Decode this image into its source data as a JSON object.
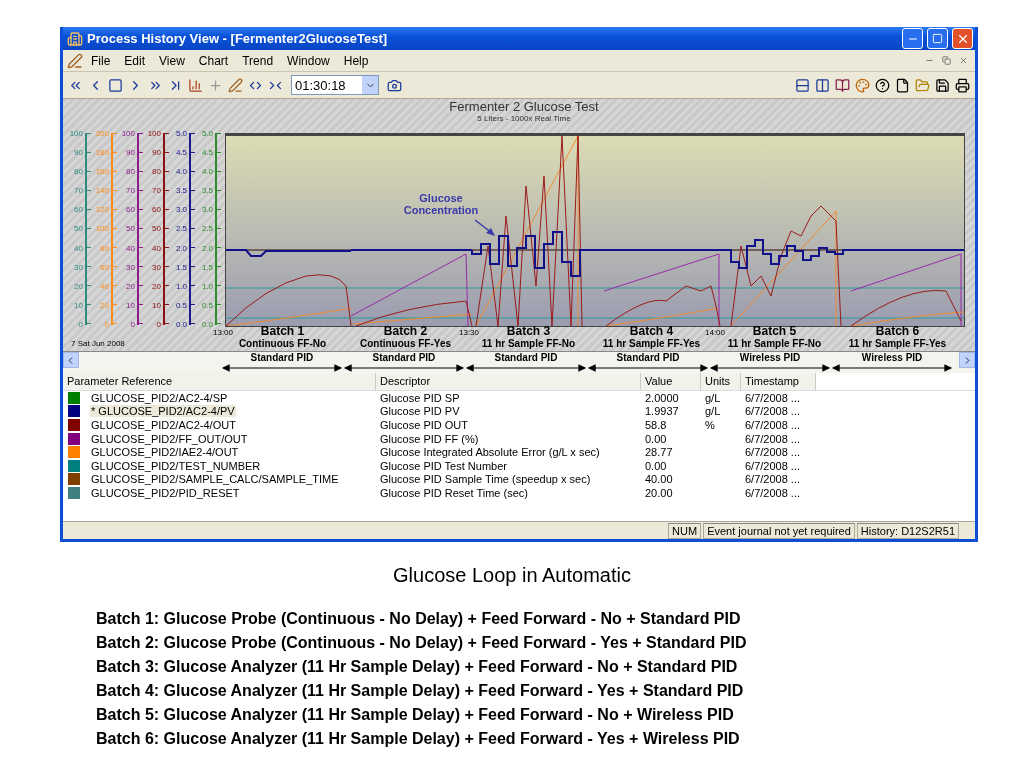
{
  "window": {
    "title": "Process History View - [Fermenter2GlucoseTest]"
  },
  "menu": [
    "File",
    "Edit",
    "View",
    "Chart",
    "Trend",
    "Window",
    "Help"
  ],
  "toolbar": {
    "time_value": "01:30:18"
  },
  "chart": {
    "title": "Fermenter 2 Glucose Test",
    "subtitle": "5 Liters - 1000x Real Time",
    "date": "7 Sat Jun 2008",
    "annotation": "Glucose Concentration",
    "axes": [
      {
        "color": "#2e8b80",
        "ticks": [
          "100",
          "90",
          "80",
          "70",
          "60",
          "50",
          "40",
          "30",
          "20",
          "10",
          "0"
        ]
      },
      {
        "color": "#ff8c1a",
        "ticks": [
          "200",
          "180",
          "160",
          "140",
          "120",
          "100",
          "80",
          "60",
          "40",
          "20",
          "0"
        ]
      },
      {
        "color": "#8b1a8b",
        "ticks": [
          "100",
          "90",
          "80",
          "70",
          "60",
          "50",
          "40",
          "30",
          "20",
          "10",
          "0"
        ]
      },
      {
        "color": "#8b1010",
        "ticks": [
          "100",
          "90",
          "80",
          "70",
          "60",
          "50",
          "40",
          "30",
          "20",
          "10",
          "0"
        ]
      },
      {
        "color": "#1a1a8b",
        "ticks": [
          "5.0",
          "4.5",
          "4.0",
          "3.5",
          "3.0",
          "2.5",
          "2.0",
          "1.5",
          "1.0",
          "0.5",
          "0.0"
        ]
      },
      {
        "color": "#2e8b2e",
        "ticks": [
          "5.0",
          "4.5",
          "4.0",
          "3.5",
          "3.0",
          "2.5",
          "2.0",
          "1.5",
          "1.0",
          "0.5",
          "0.0"
        ]
      }
    ],
    "batches": [
      {
        "time": "13:00",
        "label": "Batch 1",
        "mode": "Continuous FF-No",
        "pid": "Standard PID"
      },
      {
        "label": "Batch 2",
        "mode": "Continuous FF-Yes",
        "pid": "Standard PID"
      },
      {
        "time": "13:30",
        "label": "Batch 3",
        "mode": "11 hr Sample FF-No",
        "pid": "Standard PID"
      },
      {
        "label": "Batch 4",
        "mode": "11 hr Sample FF-Yes",
        "pid": "Standard PID"
      },
      {
        "time": "14:00",
        "label": "Batch 5",
        "mode": "11 hr Sample FF-No",
        "pid": "Wireless PID"
      },
      {
        "label": "Batch 6",
        "mode": "11 hr Sample FF-Yes",
        "pid": "Wireless PID"
      }
    ]
  },
  "table": {
    "columns": [
      "Parameter Reference",
      "Descriptor",
      "Value",
      "Units",
      "Timestamp"
    ],
    "rows": [
      {
        "color": "#008000",
        "prefix": "",
        "reference": "GLUCOSE_PID2/AC2-4/SP",
        "descriptor": "Glucose PID SP",
        "value": "2.0000",
        "units": "g/L",
        "timestamp": "6/7/2008 ...",
        "selected": false
      },
      {
        "color": "#000080",
        "prefix": "*",
        "reference": "GLUCOSE_PID2/AC2-4/PV",
        "descriptor": "Glucose PID PV",
        "value": "1.9937",
        "units": "g/L",
        "timestamp": "6/7/2008 ...",
        "selected": true
      },
      {
        "color": "#800000",
        "reference": "GLUCOSE_PID2/AC2-4/OUT",
        "descriptor": "Glucose PID OUT",
        "value": "58.8",
        "units": "%",
        "timestamp": "6/7/2008 ...",
        "selected": false
      },
      {
        "color": "#800080",
        "reference": "GLUCOSE_PID2/FF_OUT/OUT",
        "descriptor": "Glucose PID FF (%)",
        "value": "0.00",
        "timestamp": "6/7/2008 ...",
        "selected": false
      },
      {
        "color": "#ff8000",
        "reference": "GLUCOSE_PID2/IAE2-4/OUT",
        "descriptor": "Glucose Integrated Absolute Error (g/L x sec)",
        "value": "28.77",
        "timestamp": "6/7/2008 ...",
        "selected": false
      },
      {
        "color": "#008080",
        "reference": "GLUCOSE_PID2/TEST_NUMBER",
        "descriptor": "Glucose PID Test Number",
        "value": "0.00",
        "timestamp": "6/7/2008 ...",
        "selected": false
      },
      {
        "color": "#804000",
        "reference": "GLUCOSE_PID2/SAMPLE_CALC/SAMPLE_TIME",
        "descriptor": "Glucose PID Sample Time (speedup x sec)",
        "value": "40.00",
        "timestamp": "6/7/2008 ...",
        "selected": false
      },
      {
        "color": "#408080",
        "reference": "GLUCOSE_PID2/PID_RESET",
        "descriptor": "Glucose PID Reset Time (sec)",
        "value": "20.00",
        "timestamp": "6/7/2008 ...",
        "selected": false
      }
    ]
  },
  "status_bar": [
    "NUM",
    "Event journal not yet required",
    "History: D12S2R51"
  ],
  "slide": {
    "caption": "Glucose Loop in Automatic",
    "notes": [
      "Batch 1: Glucose Probe (Continuous - No Delay) + Feed Forward - No + Standard PID",
      "Batch 2: Glucose Probe (Continuous - No Delay) + Feed Forward - Yes + Standard PID",
      "Batch 3: Glucose Analyzer (11 Hr Sample Delay) + Feed Forward - No + Standard PID",
      "Batch 4: Glucose Analyzer (11 Hr Sample Delay) + Feed Forward - Yes + Standard PID",
      "Batch 5: Glucose Analyzer (11 Hr Sample Delay) + Feed Forward - No + Wireless PID",
      "Batch 6: Glucose Analyzer (11 Hr Sample Delay) + Feed Forward - Yes + Wireless PID"
    ]
  }
}
